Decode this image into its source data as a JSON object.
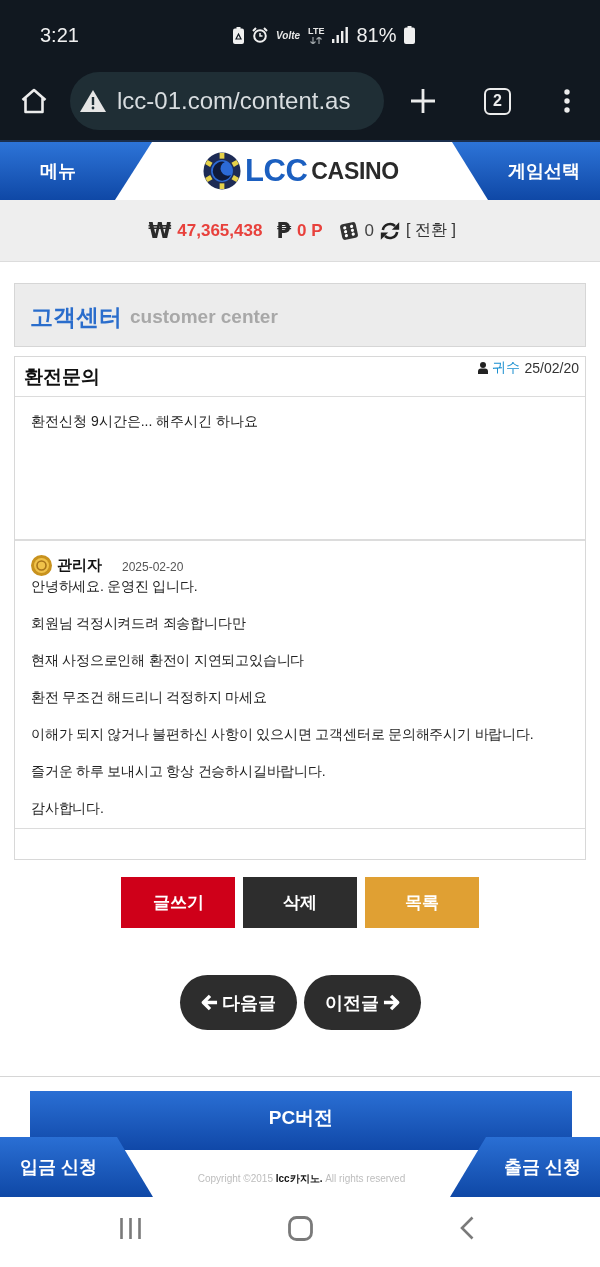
{
  "status_bar": {
    "time": "3:21",
    "volte": "Volte",
    "network": "LTE",
    "battery": "81%"
  },
  "browser": {
    "url": "lcc-01.com/content.as",
    "tab_count": "2"
  },
  "header": {
    "menu": "메뉴",
    "logo_brand": "LCC",
    "logo_text": "CASINO",
    "game_select": "게임선택"
  },
  "balance": {
    "money_sign": "₩",
    "money": "47,365,438",
    "point_sign": "₱",
    "points": "0 P",
    "chips": "0",
    "convert": "[ 전환 ]"
  },
  "section": {
    "title": "고객센터",
    "subtitle": "customer center"
  },
  "post": {
    "title": "환전문의",
    "author": "귀수",
    "date": "25/02/20",
    "body": "환전신청 9시간은... 해주시긴 하나요"
  },
  "reply": {
    "author": "관리자",
    "date": "2025-02-20",
    "paragraphs": [
      "안녕하세요. 운영진 입니다.",
      "회원님 걱정시켜드려 죄송합니다만",
      "현재 사정으로인해 환전이 지연되고있습니다",
      "환전 무조건 해드리니 걱정하지 마세요",
      "이해가 되지 않거나 불편하신 사항이 있으시면 고객센터로 문의해주시기 바랍니다.",
      "즐거운 하루 보내시고 항상 건승하시길바랍니다.",
      "감사합니다."
    ]
  },
  "actions": [
    {
      "kind": "write",
      "label": "글쓰기"
    },
    {
      "kind": "delete",
      "label": "삭제"
    },
    {
      "kind": "list",
      "label": "목록"
    }
  ],
  "pager": [
    {
      "kind": "next",
      "label": "다음글"
    },
    {
      "kind": "prev",
      "label": "이전글"
    }
  ],
  "footer": {
    "pc_version": "PC버전",
    "deposit": "입금 신청",
    "withdraw": "출금 신청",
    "copyright": "Copyright ©2015 **lcc카지노.** All rights reserved"
  }
}
